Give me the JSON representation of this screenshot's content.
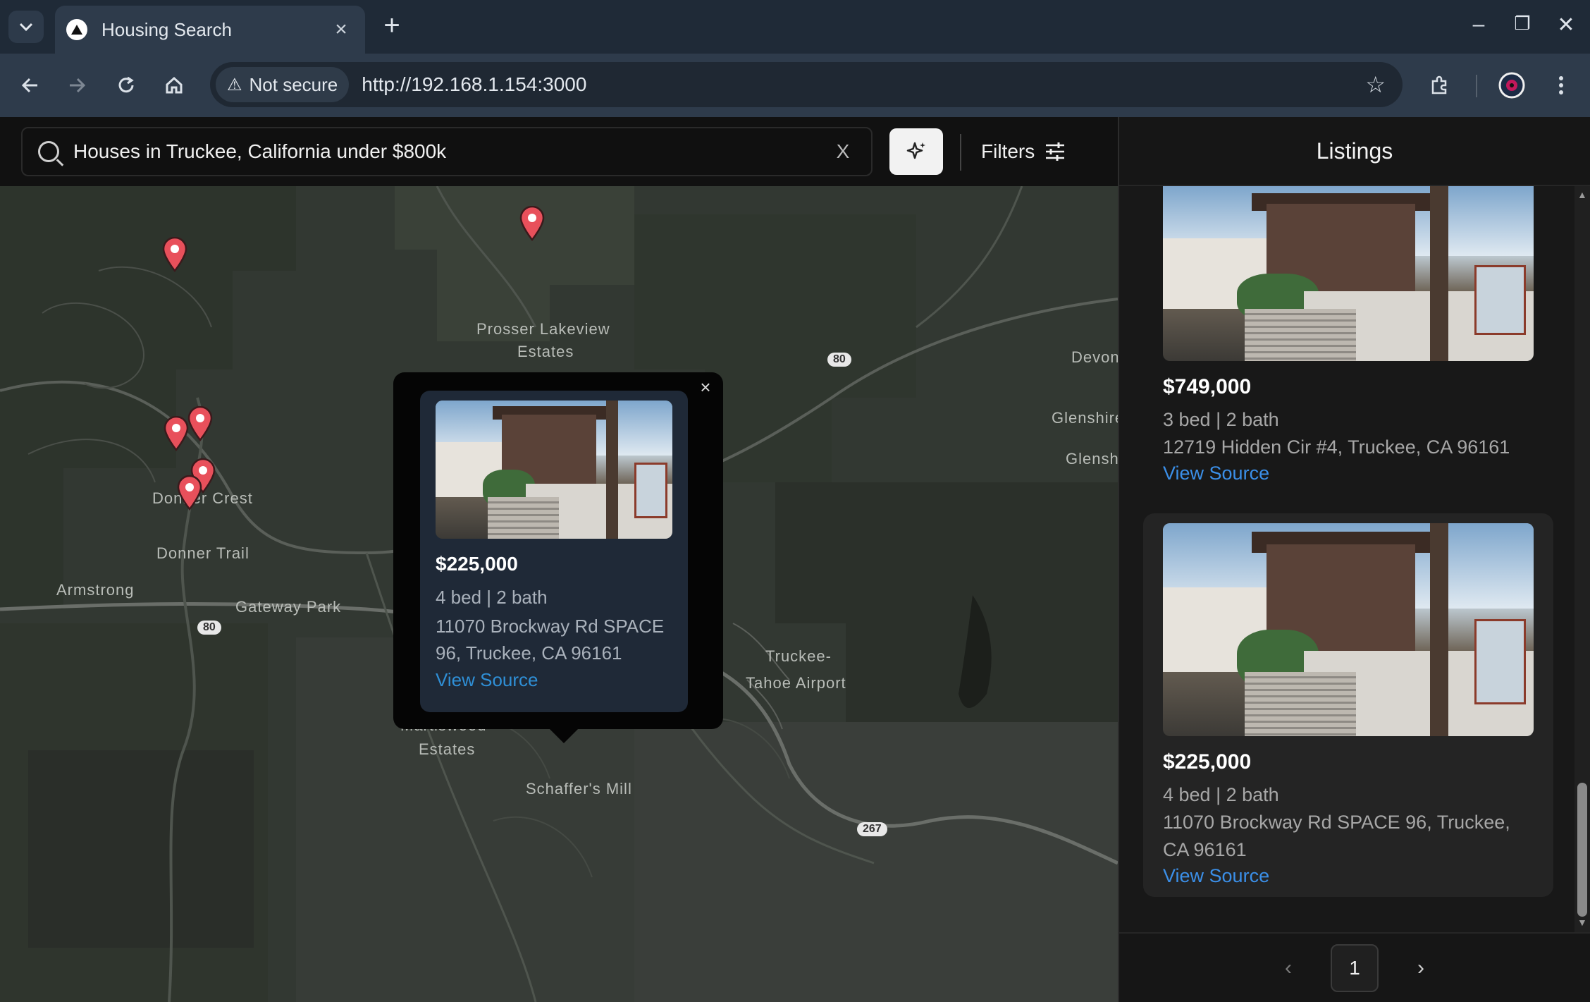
{
  "browser": {
    "tab_title": "Housing Search",
    "tab_close": "×",
    "new_tab": "+",
    "security_label": "Not secure",
    "url": "http://192.168.1.154:3000",
    "window_controls": {
      "minimize": "–",
      "restore": "❐",
      "close": "✕"
    }
  },
  "search": {
    "query": "Houses in Truckee, California under $800k",
    "clear_label": "X",
    "ai_icon": "sparkle-icon",
    "filters_label": "Filters"
  },
  "map": {
    "labels": {
      "prosser_a": "Prosser Lakeview",
      "prosser_b": "Estates",
      "devon": "Devon",
      "glenshire": "Glenshire",
      "glensh": "Glensh",
      "donner_crest": "Donner Crest",
      "donner_trail": "Donner Trail",
      "armstrong": "Armstrong",
      "gateway_park": "Gateway Park",
      "airport_a": "Truckee-",
      "airport_b": "Tahoe Airport",
      "martiswood_a": "Martiswood",
      "martiswood_b": "Estates",
      "schaffers_mill": "Schaffer's Mill"
    },
    "highways": {
      "i80_a": "80",
      "i80_b": "80",
      "sr267": "267"
    },
    "popup": {
      "close_label": "×",
      "price": "$225,000",
      "beds_baths": "4 bed | 2 bath",
      "address": "11070 Brockway Rd SPACE 96, Truckee, CA 96161",
      "link": "View Source"
    }
  },
  "listings": {
    "title": "Listings",
    "items": [
      {
        "price": "$749,000",
        "beds_baths": "3 bed | 2 bath",
        "address": "12719 Hidden Cir #4, Truckee, CA 96161",
        "link": "View Source"
      },
      {
        "price": "$225,000",
        "beds_baths": "4 bed | 2 bath",
        "address": "11070 Brockway Rd SPACE 96, Truckee, CA 96161",
        "link": "View Source"
      }
    ],
    "pagination": {
      "prev": "‹",
      "page": "1",
      "next": "›"
    }
  },
  "colors": {
    "pin": "#e8505b",
    "accent_link": "#3b8fe8",
    "map_bg": "#343a33"
  }
}
